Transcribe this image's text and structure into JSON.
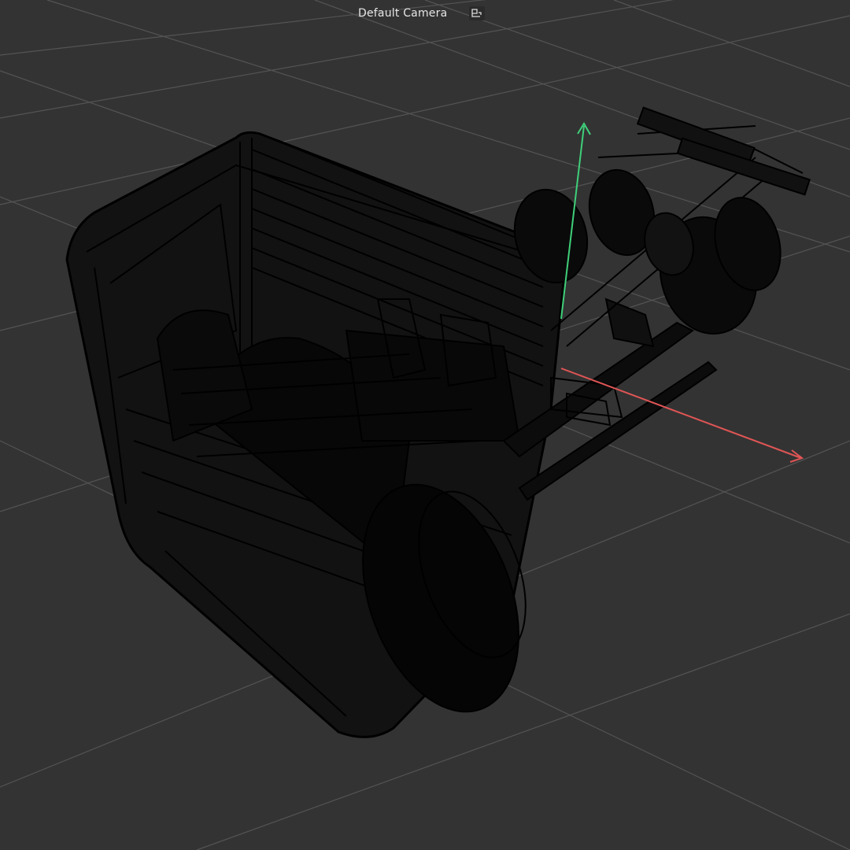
{
  "viewport": {
    "camera_label": "Default Camera",
    "camera_icon": "camera-link-icon",
    "colors": {
      "background": "#333333",
      "grid": "#5a5a5a",
      "wire": "#000000",
      "axis_x": "#e05555",
      "axis_y": "#3fcf7a"
    }
  }
}
